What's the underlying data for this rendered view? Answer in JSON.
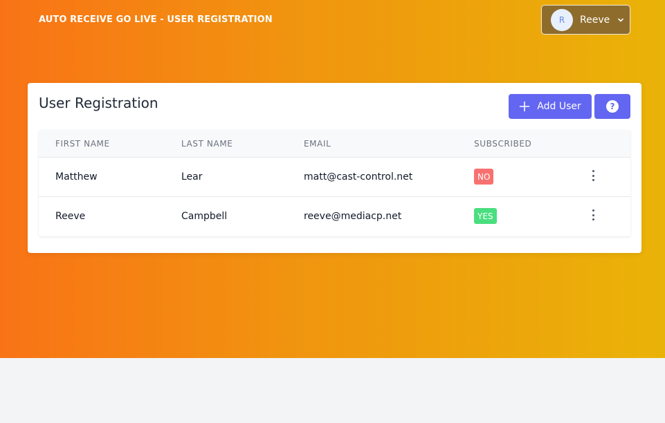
{
  "header": {
    "app_title": "AUTO RECEIVE GO LIVE - USER REGISTRATION",
    "user": {
      "initial": "R",
      "name": "Reeve",
      "menu_icon": "chevron-down-icon"
    }
  },
  "card": {
    "title": "User Registration",
    "add_button_label": "Add User",
    "add_button_icon": "plus-icon",
    "help_button_icon": "question-circle-icon",
    "help_symbol": "?"
  },
  "table": {
    "columns": [
      "FIRST NAME",
      "LAST NAME",
      "EMAIL",
      "SUBSCRIBED"
    ],
    "rows": [
      {
        "first_name": "Matthew",
        "last_name": "Lear",
        "email": "matt@cast-control.net",
        "subscribed": "NO"
      },
      {
        "first_name": "Reeve",
        "last_name": "Campbell",
        "email": "reeve@mediacp.net",
        "subscribed": "YES"
      }
    ]
  },
  "colors": {
    "accent": "#6366f1",
    "badge_no": "#f87171",
    "badge_yes": "#4ade80",
    "gradient_start": "#f97316",
    "gradient_end": "#eab308"
  }
}
